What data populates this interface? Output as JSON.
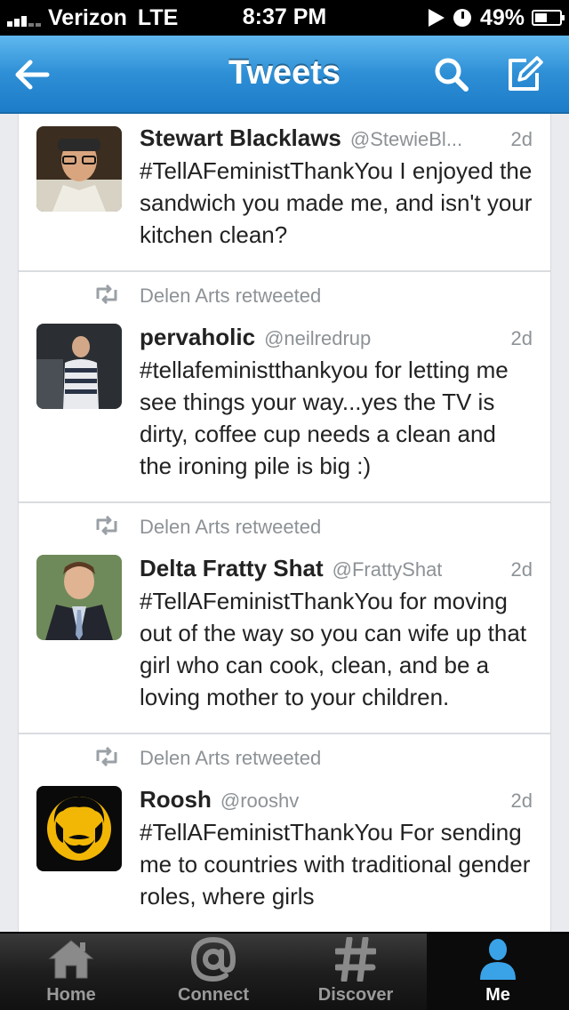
{
  "status_bar": {
    "carrier": "Verizon",
    "network": "LTE",
    "time": "8:37 PM",
    "battery": "49%",
    "battery_level": 0.49
  },
  "nav": {
    "title": "Tweets",
    "back_icon": "back-arrow-icon",
    "search_icon": "search-icon",
    "compose_icon": "compose-icon"
  },
  "tweets": [
    {
      "retweeted_by": "",
      "name": "Stewart Blacklaws",
      "handle": "@StewieBl...",
      "time": "2d",
      "text": "#TellAFeministThankYou I enjoyed the sandwich you made me, and isn't your kitchen clean?"
    },
    {
      "retweeted_by": "Delen Arts retweeted",
      "name": "pervaholic",
      "handle": "@neilredrup",
      "time": "2d",
      "text": "#tellafeministthankyou for letting me see things your way...yes the TV is dirty, coffee cup needs a clean and the ironing pile is big :)"
    },
    {
      "retweeted_by": "Delen Arts retweeted",
      "name": "Delta Fratty Shat",
      "handle": "@FrattyShat",
      "time": "2d",
      "text": "#TellAFeministThankYou for moving out of the way so you can wife up that girl who can cook, clean, and be a loving mother to your children."
    },
    {
      "retweeted_by": "Delen Arts retweeted",
      "name": "Roosh",
      "handle": "@rooshv",
      "time": "2d",
      "text": "#TellAFeministThankYou For sending me to countries with traditional gender roles, where girls"
    }
  ],
  "tabs": [
    {
      "label": "Home",
      "icon": "home-icon",
      "active": false
    },
    {
      "label": "Connect",
      "icon": "at-icon",
      "active": false
    },
    {
      "label": "Discover",
      "icon": "hash-icon",
      "active": false
    },
    {
      "label": "Me",
      "icon": "person-icon",
      "active": true
    }
  ],
  "colors": {
    "nav_blue": "#2e8fd6",
    "active_tab_icon": "#3aa3e8"
  }
}
